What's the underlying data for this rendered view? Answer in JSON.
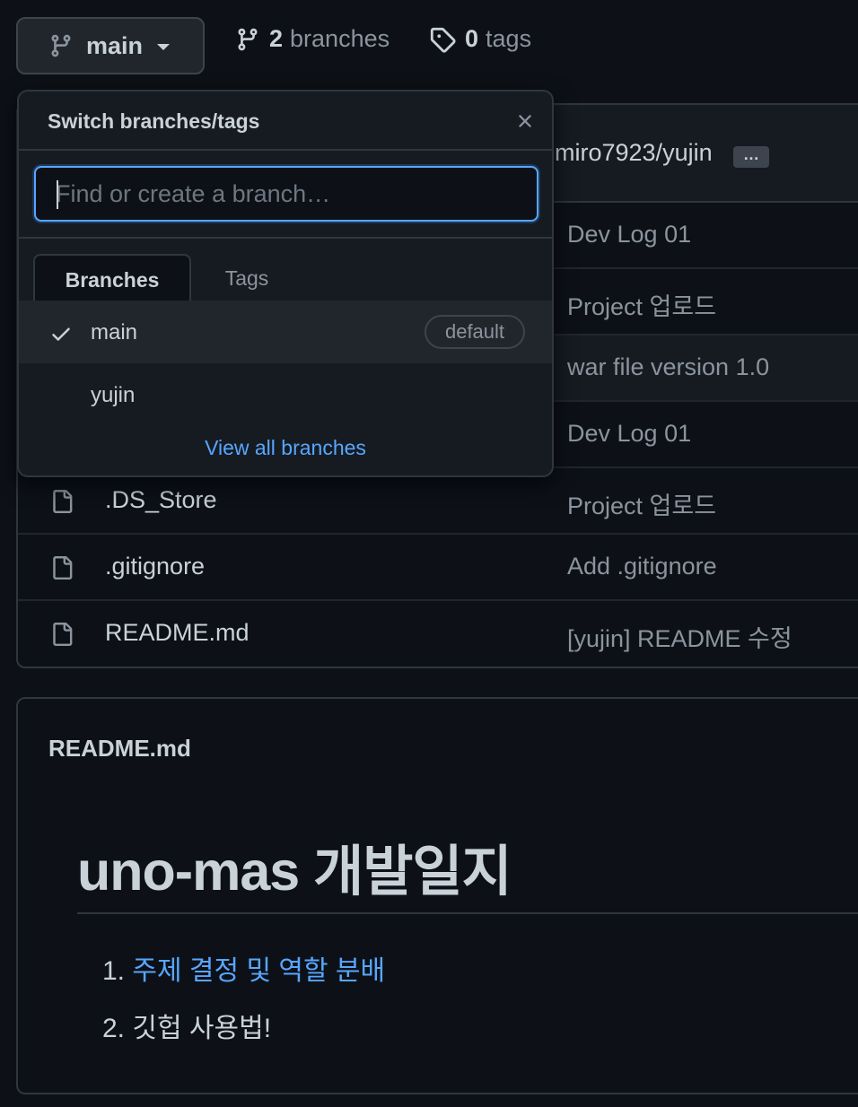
{
  "toolbar": {
    "branch_button": "main",
    "branches_count": "2",
    "branches_label": "branches",
    "tags_count": "0",
    "tags_label": "tags"
  },
  "repo": {
    "commit_author": "miro7923/yujin",
    "more_label": "…",
    "files": [
      {
        "name": "",
        "message": "Dev Log 01",
        "icon": "folder-icon"
      },
      {
        "name": "",
        "message": "Project 업로드",
        "icon": "folder-icon"
      },
      {
        "name": "",
        "message": "war file version 1.0",
        "icon": "file-icon"
      },
      {
        "name": "",
        "message": "Dev Log 01",
        "icon": "file-icon"
      },
      {
        "name": ".DS_Store",
        "message": "Project 업로드",
        "icon": "file-icon"
      },
      {
        "name": ".gitignore",
        "message": "Add .gitignore",
        "icon": "file-icon"
      },
      {
        "name": "README.md",
        "message": "[yujin] README 수정",
        "icon": "file-icon"
      }
    ]
  },
  "readme": {
    "title": "README.md",
    "heading": "uno-mas 개발일지",
    "items": [
      {
        "num": "1.",
        "text": "주제 결정 및 역할 분배",
        "link": true
      },
      {
        "num": "2.",
        "text": "깃헙 사용법!",
        "link": false
      }
    ]
  },
  "dropdown": {
    "title": "Switch branches/tags",
    "search_placeholder": "Find or create a branch…",
    "tabs": [
      "Branches",
      "Tags"
    ],
    "branches": [
      {
        "name": "main",
        "selected": true,
        "badge": "default"
      },
      {
        "name": "yujin",
        "selected": false,
        "badge": ""
      }
    ],
    "view_all": "View all branches"
  },
  "colors": {
    "background": "#0d1117",
    "accent": "#58a6ff",
    "border": "#30363d"
  }
}
